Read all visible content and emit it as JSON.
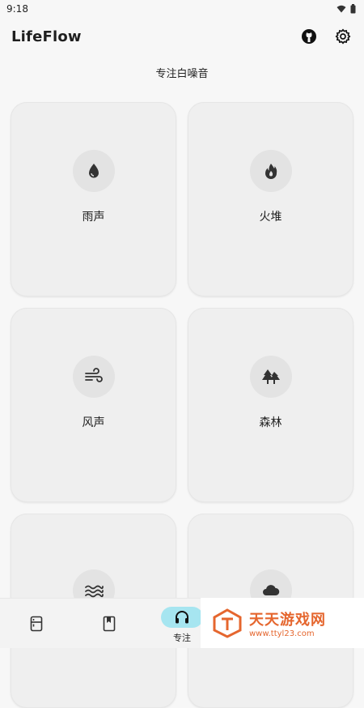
{
  "status_bar": {
    "time": "9:18"
  },
  "app_bar": {
    "title": "LifeFlow",
    "actions": [
      {
        "name": "github-icon"
      },
      {
        "name": "gear-icon"
      }
    ]
  },
  "section": {
    "title": "专注白噪音"
  },
  "cards": [
    {
      "label": "雨声",
      "icon": "water-drop-icon"
    },
    {
      "label": "火堆",
      "icon": "fire-icon"
    },
    {
      "label": "风声",
      "icon": "wind-icon"
    },
    {
      "label": "森林",
      "icon": "forest-icon"
    },
    {
      "label": "",
      "icon": "waves-icon"
    },
    {
      "label": "",
      "icon": "cloud-icon"
    }
  ],
  "bottom_nav": {
    "items": [
      {
        "label": "",
        "icon": "fridge-icon"
      },
      {
        "label": "",
        "icon": "bookmark-book-icon"
      },
      {
        "label": "专注",
        "icon": "headphones-icon",
        "active": true
      }
    ]
  },
  "watermark": {
    "title": "天天游戏网",
    "url": "www.ttyl23.com"
  }
}
